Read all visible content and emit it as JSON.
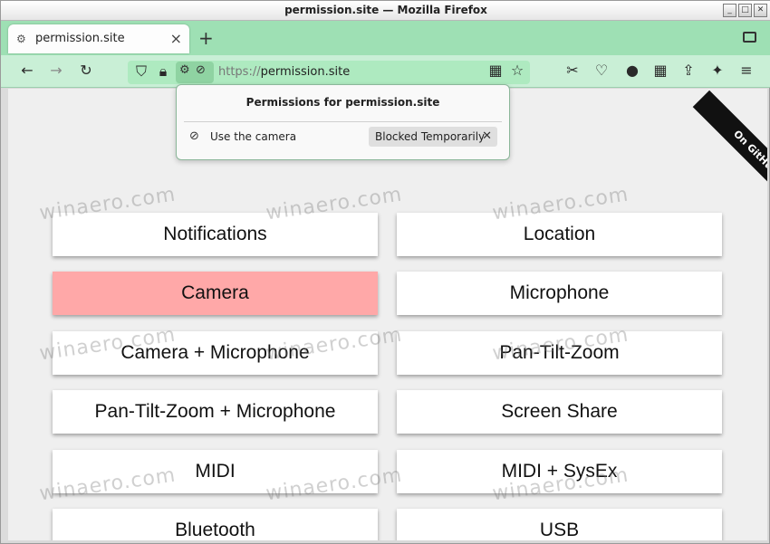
{
  "window": {
    "title": "permission.site — Mozilla Firefox"
  },
  "tab": {
    "title": "permission.site"
  },
  "urlbar": {
    "scheme": "https://",
    "host": "permission.site"
  },
  "popup": {
    "title": "Permissions for permission.site",
    "permission_label": "Use the camera",
    "state": "Blocked Temporarily"
  },
  "ribbon": {
    "label": "On GitHub"
  },
  "buttons": [
    {
      "label": "Notifications",
      "blocked": false
    },
    {
      "label": "Location",
      "blocked": false
    },
    {
      "label": "Camera",
      "blocked": true
    },
    {
      "label": "Microphone",
      "blocked": false
    },
    {
      "label": "Camera + Microphone",
      "blocked": false
    },
    {
      "label": "Pan-Tilt-Zoom",
      "blocked": false
    },
    {
      "label": "Pan-Tilt-Zoom + Microphone",
      "blocked": false
    },
    {
      "label": "Screen Share",
      "blocked": false
    },
    {
      "label": "MIDI",
      "blocked": false
    },
    {
      "label": "MIDI + SysEx",
      "blocked": false
    },
    {
      "label": "Bluetooth",
      "blocked": false
    },
    {
      "label": "USB",
      "blocked": false
    }
  ],
  "watermark": "winaero.com",
  "colors": {
    "tabbar": "#9ee0b4",
    "navbar": "#c9efd6",
    "blocked": "#ffa8a8"
  }
}
